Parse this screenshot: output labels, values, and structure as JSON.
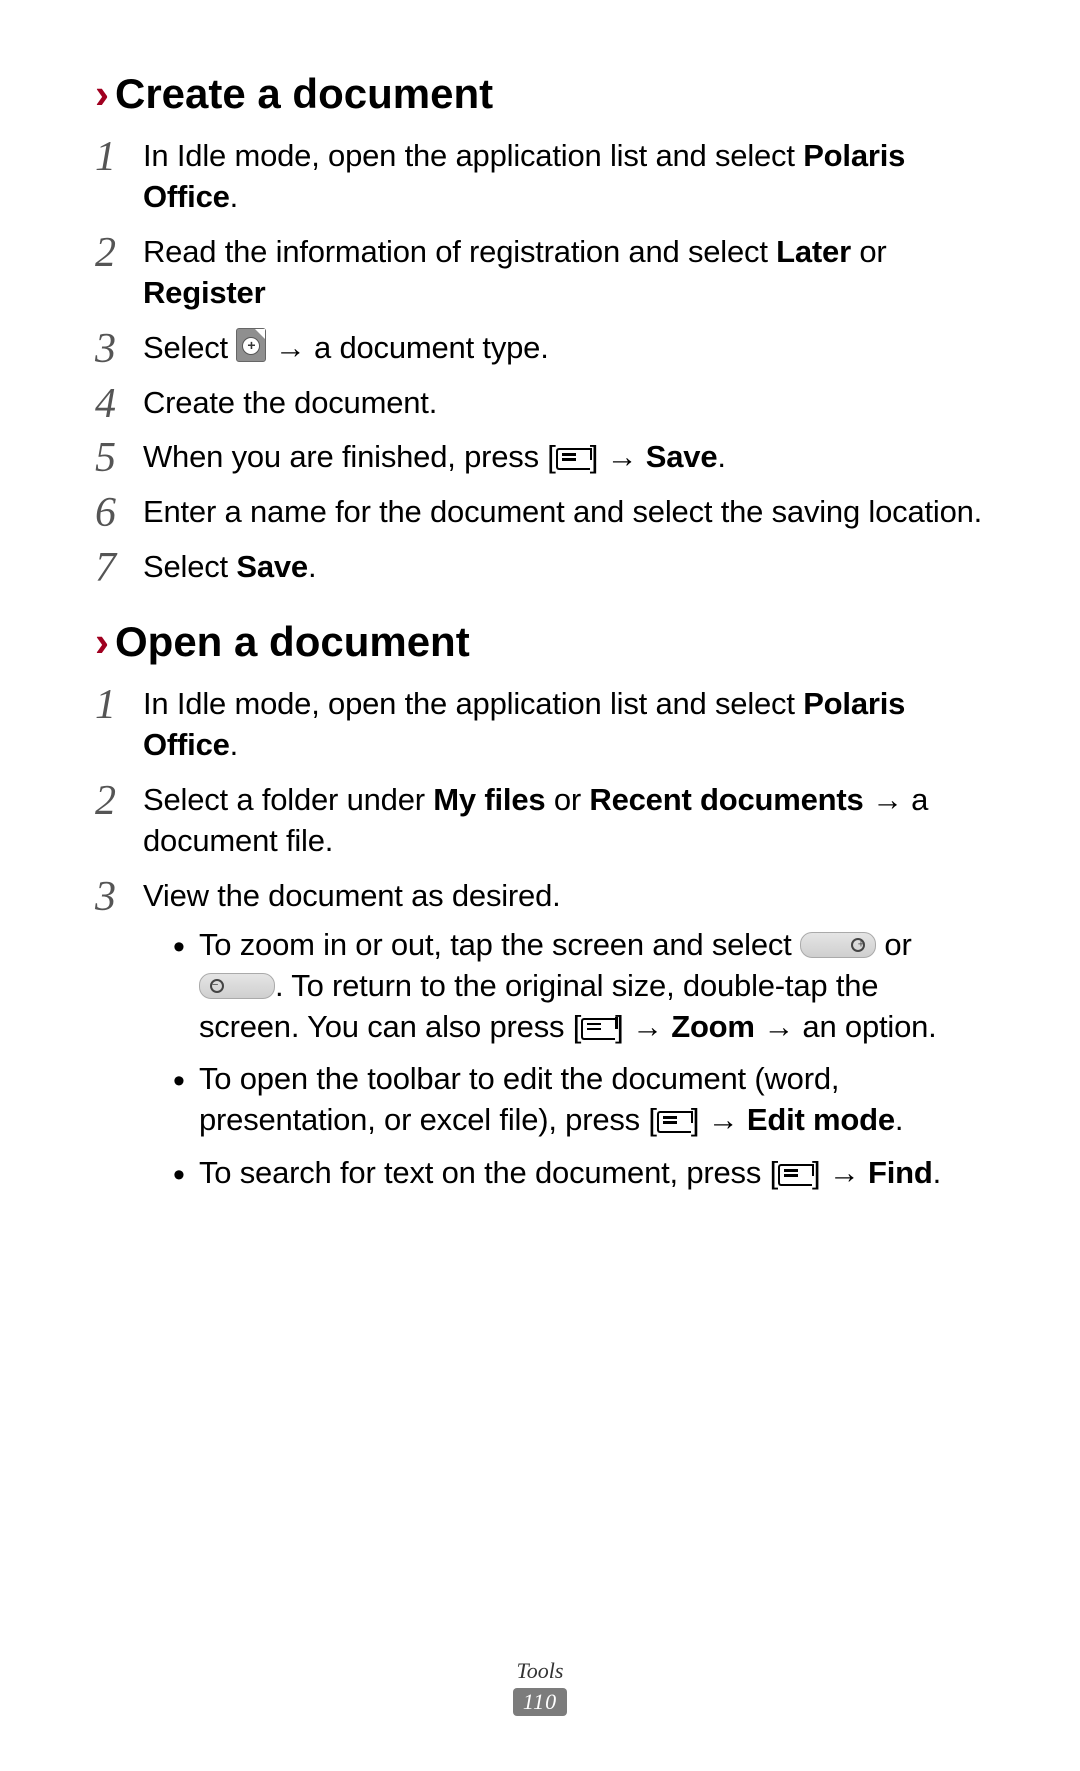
{
  "sections": {
    "create": {
      "title": "Create a document",
      "steps": {
        "s1a": "In Idle mode, open the application list and select ",
        "s1b": "Polaris Office",
        "s1c": ".",
        "s2a": "Read the information of registration and select ",
        "s2b": "Later",
        "s2c": " or ",
        "s2d": "Register",
        "s3a": "Select ",
        "s3b": " → a document type.",
        "s4": "Create the document.",
        "s5a": "When you are finished, press [",
        "s5b": "] → ",
        "s5c": "Save",
        "s5d": ".",
        "s6": "Enter a name for the document and select the saving location.",
        "s7a": "Select ",
        "s7b": "Save",
        "s7c": "."
      }
    },
    "open": {
      "title": "Open a document",
      "steps": {
        "s1a": "In Idle mode, open the application list and select ",
        "s1b": "Polaris Office",
        "s1c": ".",
        "s2a": "Select a folder under ",
        "s2b": "My files",
        "s2c": " or ",
        "s2d": "Recent documents",
        "s2e": " → a document file.",
        "s3": "View the document as desired.",
        "b1a": "To zoom in or out, tap the screen and select ",
        "b1b": " or ",
        "b1c": ". To return to the original size, double-tap the screen. You can also press [",
        "b1d": "] → ",
        "b1e": "Zoom",
        "b1f": " → an option.",
        "b2a": "To open the toolbar to edit the document (word, presentation, or excel file), press [",
        "b2b": "] → ",
        "b2c": "Edit mode",
        "b2d": ".",
        "b3a": "To search for text on the document, press [",
        "b3b": "] → ",
        "b3c": "Find",
        "b3d": "."
      }
    }
  },
  "footer": {
    "section": "Tools",
    "page": "110"
  }
}
